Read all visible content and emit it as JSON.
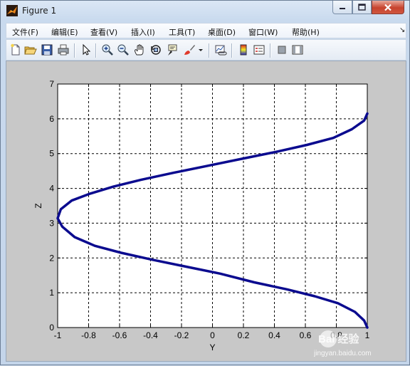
{
  "window": {
    "title": "Figure 1",
    "colors": {
      "frame": "#c9daee",
      "close": "#c7432e",
      "figure_bg": "#c8c8c8"
    }
  },
  "menu": {
    "items": [
      {
        "label": "文件(F)"
      },
      {
        "label": "编辑(E)"
      },
      {
        "label": "查看(V)"
      },
      {
        "label": "插入(I)"
      },
      {
        "label": "工具(T)"
      },
      {
        "label": "桌面(D)"
      },
      {
        "label": "窗口(W)"
      },
      {
        "label": "帮助(H)"
      }
    ]
  },
  "toolbar": {
    "icons": [
      "new-figure-icon",
      "open-file-icon",
      "save-icon",
      "print-icon",
      "edit-plot-arrow-icon",
      "zoom-in-icon",
      "zoom-out-icon",
      "pan-hand-icon",
      "rotate-3d-icon",
      "data-cursor-icon",
      "brush-icon",
      "brush-dropdown-icon",
      "link-plot-icon",
      "insert-colorbar-icon",
      "insert-legend-icon",
      "hide-plot-tools-icon",
      "show-plot-tools-icon"
    ]
  },
  "chart_data": {
    "type": "line",
    "xlabel": "Y",
    "ylabel": "Z",
    "xlim": [
      -1,
      1
    ],
    "ylim": [
      0,
      7
    ],
    "xticks": [
      "-1",
      "-0.8",
      "-0.6",
      "-0.4",
      "-0.2",
      "0",
      "0.2",
      "0.4",
      "0.6",
      "0.8",
      "1"
    ],
    "yticks": [
      "0",
      "1",
      "2",
      "3",
      "4",
      "5",
      "6",
      "7"
    ],
    "grid": true,
    "line_color": "#0b0b8f",
    "series": [
      {
        "x": [
          1.0,
          0.98,
          0.92,
          0.81,
          0.66,
          0.48,
          0.27,
          0.05,
          -0.17,
          -0.39,
          -0.59,
          -0.76,
          -0.89,
          -0.97,
          -1.0,
          -0.98,
          -0.91,
          -0.79,
          -0.64,
          -0.46,
          -0.25,
          -0.03,
          0.19,
          0.41,
          0.61,
          0.78,
          0.9,
          0.98,
          1.0
        ],
        "y": [
          0.0,
          0.2,
          0.45,
          0.7,
          0.9,
          1.1,
          1.3,
          1.55,
          1.75,
          1.95,
          2.15,
          2.35,
          2.6,
          2.9,
          3.14,
          3.4,
          3.65,
          3.85,
          4.05,
          4.25,
          4.45,
          4.65,
          4.85,
          5.05,
          5.25,
          5.45,
          5.7,
          5.95,
          6.15
        ]
      }
    ]
  },
  "watermark": {
    "text": "Bai 经验",
    "subtext": "jingyan.baidu.com"
  }
}
